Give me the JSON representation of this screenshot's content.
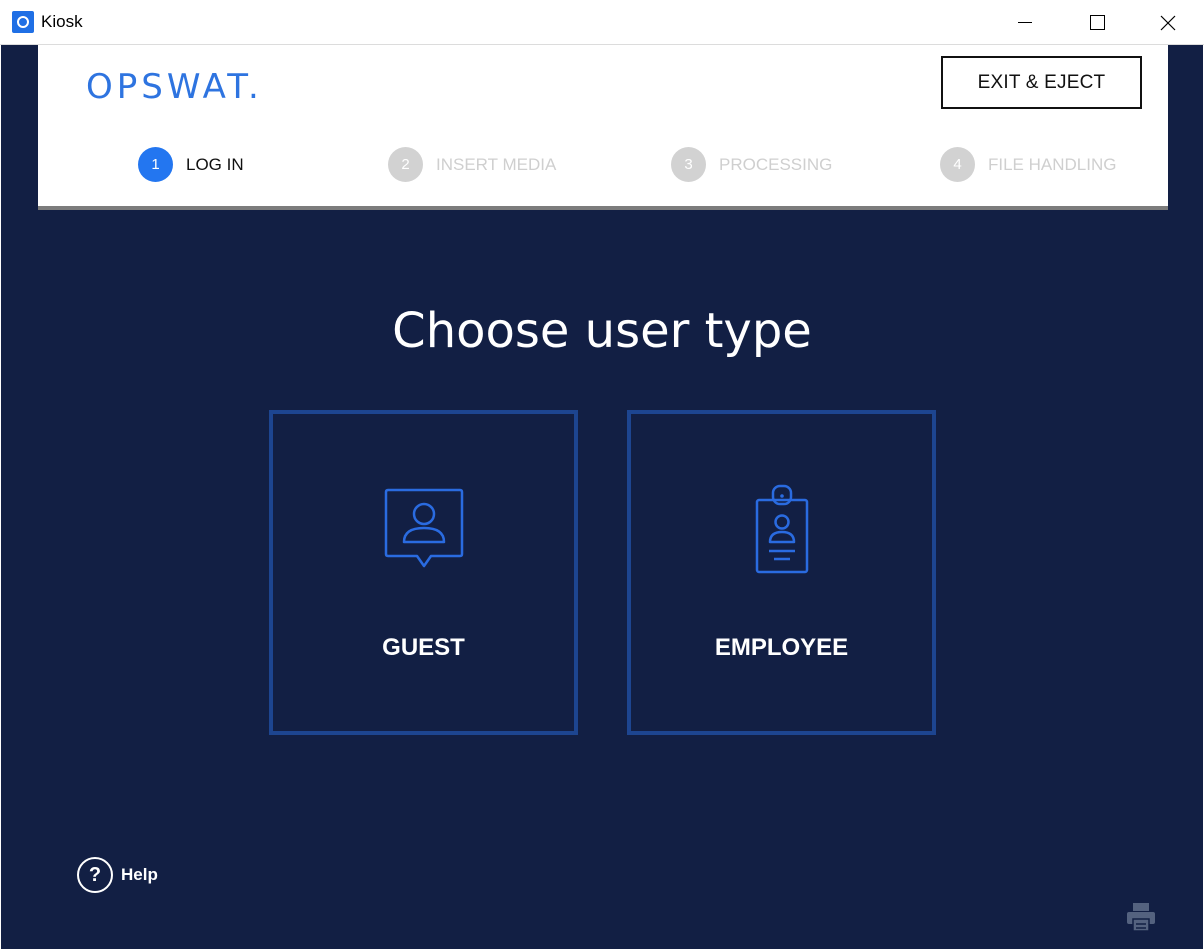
{
  "window": {
    "title": "Kiosk",
    "controls": {
      "minimize": "minimize-icon",
      "maximize": "maximize-icon",
      "close": "close-icon"
    }
  },
  "header": {
    "logo_text": "OPSWAT.",
    "exit_button": "EXIT & EJECT",
    "steps": [
      {
        "number": "1",
        "label": "LOG IN",
        "state": "active"
      },
      {
        "number": "2",
        "label": "INSERT MEDIA",
        "state": "inactive"
      },
      {
        "number": "3",
        "label": "PROCESSING",
        "state": "inactive"
      },
      {
        "number": "4",
        "label": "FILE HANDLING",
        "state": "inactive"
      }
    ]
  },
  "main": {
    "heading": "Choose user type",
    "options": [
      {
        "label": "GUEST",
        "icon": "guest-user-icon"
      },
      {
        "label": "EMPLOYEE",
        "icon": "employee-badge-icon"
      }
    ]
  },
  "footer": {
    "help_symbol": "?",
    "help_label": "Help",
    "printer_icon": "printer-icon"
  },
  "colors": {
    "background": "#121f44",
    "accent": "#2376f0",
    "card_border": "#1d4590",
    "step_inactive": "#d2d2d2",
    "logo": "#2e74e0"
  }
}
